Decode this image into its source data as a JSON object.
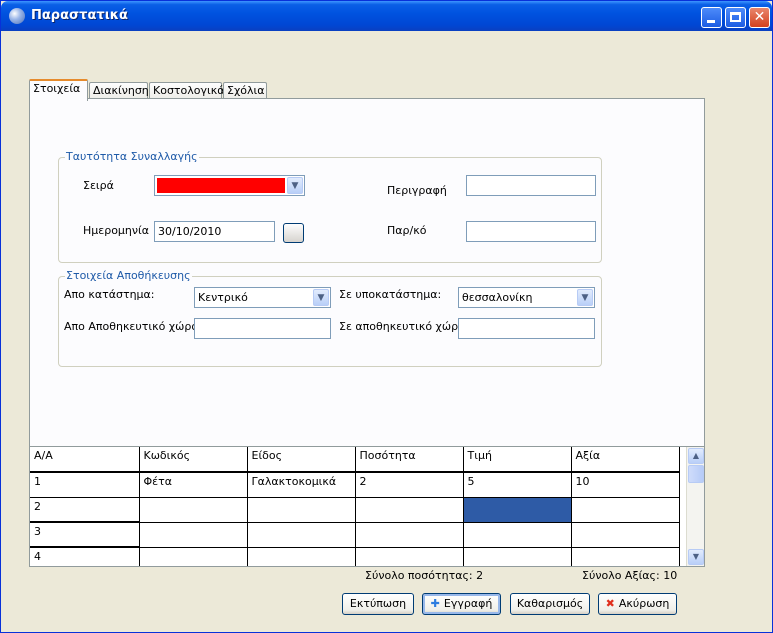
{
  "window": {
    "title": "Παραστατικά",
    "minimize_label": "_",
    "maximize_label": "□",
    "close_label": "✕"
  },
  "tabs": [
    {
      "label": "Στοιχεία",
      "active": true
    },
    {
      "label": "Διακίνηση",
      "active": false
    },
    {
      "label": "Κοστολογικά",
      "active": false
    },
    {
      "label": "Σχόλια",
      "active": false
    }
  ],
  "transaction_group": {
    "title": "Ταυτότητα Συναλλαγής",
    "series_label": "Σειρά",
    "series_value": "",
    "series_color": "#ff0000",
    "date_label": "Ημερομηνία",
    "date_value": "30/10/2010",
    "description_label": "Περιγραφή",
    "description_value": "",
    "parko_label": "Παρ/κό",
    "parko_value": ""
  },
  "storage_group": {
    "title": "Στοιχεία Αποθήκευσης",
    "from_store_label": "Απο κατάστημα:",
    "from_store_value": "Κεντρικό",
    "to_branch_label": "Σε υποκατάστημα:",
    "to_branch_value": "θεσσαλονίκη",
    "from_warehouse_label": "Απο Αποθηκευτικό χώρο:",
    "from_warehouse_value": "",
    "to_warehouse_label": "Σε αποθηκευτικό χώρο:",
    "to_warehouse_value": ""
  },
  "grid": {
    "columns": [
      "Α/Α",
      "Κωδικός",
      "Είδος",
      "Ποσότητα",
      "Τιμή",
      "Αξία"
    ],
    "rows": [
      [
        "1",
        "Φέτα",
        "Γαλακτοκομικά",
        "2",
        "5",
        "10"
      ],
      [
        "2",
        "",
        "",
        "",
        "",
        ""
      ],
      [
        "3",
        "",
        "",
        "",
        "",
        ""
      ],
      [
        "4",
        "",
        "",
        "",
        "",
        ""
      ]
    ]
  },
  "totals": {
    "quantity_total": "Σύνολο ποσότητας: 2",
    "value_total": "Σύνολο Αξίας: 10"
  },
  "buttons": {
    "print": "Εκτύπωση",
    "save": "Εγγραφή",
    "clear": "Καθαρισμός",
    "cancel": "Ακύρωση"
  },
  "icons": {
    "save_icon": "plus-icon",
    "cancel_icon": "cross-icon"
  }
}
